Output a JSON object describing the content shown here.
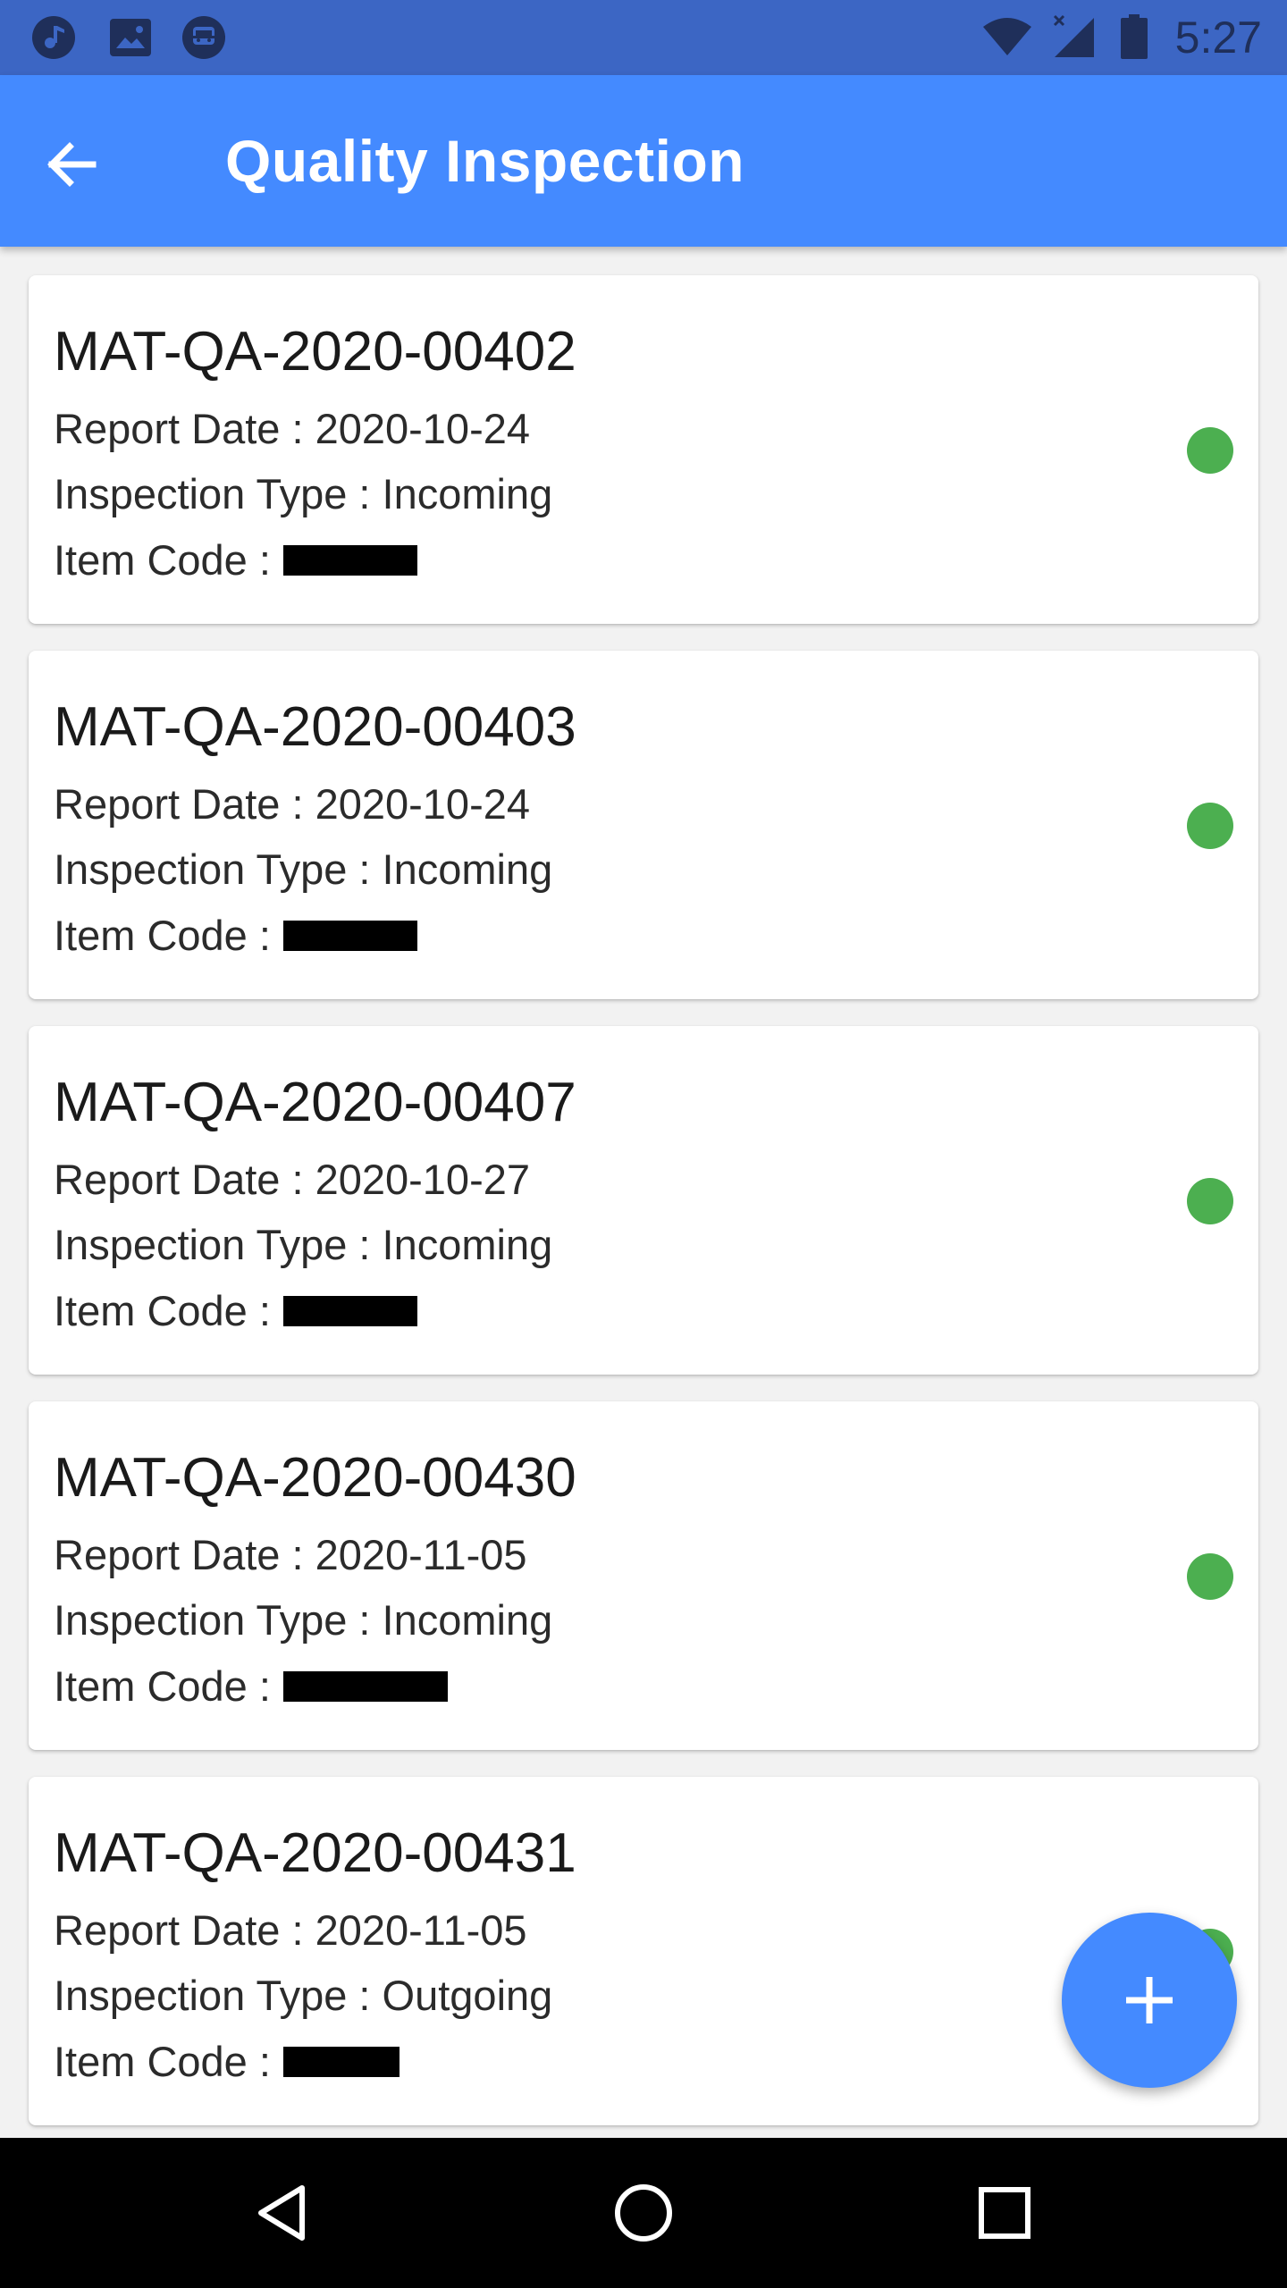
{
  "status_bar": {
    "time": "5:27",
    "left_icons": [
      "music-note-icon",
      "image-icon",
      "subway-icon"
    ],
    "right_icons": [
      "wifi-icon",
      "cell-signal-icon",
      "battery-icon"
    ]
  },
  "app_bar": {
    "title": "Quality Inspection",
    "back_icon": "arrow-back-icon"
  },
  "colors": {
    "primary": "#448aff",
    "status_bar": "#3c66c4",
    "status_ok": "#4caf50"
  },
  "inspections": [
    {
      "id": "MAT-QA-2020-00402",
      "report_date": "Report Date : 2020-10-24",
      "inspection_type": "Inspection Type : Incoming",
      "item_code_label": "Item Code :",
      "status_color": "#4caf50"
    },
    {
      "id": "MAT-QA-2020-00403",
      "report_date": "Report Date : 2020-10-24",
      "inspection_type": "Inspection Type : Incoming",
      "item_code_label": "Item Code :",
      "status_color": "#4caf50"
    },
    {
      "id": "MAT-QA-2020-00407",
      "report_date": "Report Date : 2020-10-27",
      "inspection_type": "Inspection Type : Incoming",
      "item_code_label": "Item Code :",
      "status_color": "#4caf50"
    },
    {
      "id": "MAT-QA-2020-00430",
      "report_date": "Report Date : 2020-11-05",
      "inspection_type": "Inspection Type : Incoming",
      "item_code_label": "Item Code :",
      "status_color": "#4caf50"
    },
    {
      "id": "MAT-QA-2020-00431",
      "report_date": "Report Date : 2020-11-05",
      "inspection_type": "Inspection Type : Outgoing",
      "item_code_label": "Item Code :",
      "status_color": "#4caf50"
    }
  ],
  "fab": {
    "icon": "add-icon"
  },
  "nav_bar": {
    "icons": [
      "nav-back-icon",
      "nav-home-icon",
      "nav-recents-icon"
    ]
  }
}
